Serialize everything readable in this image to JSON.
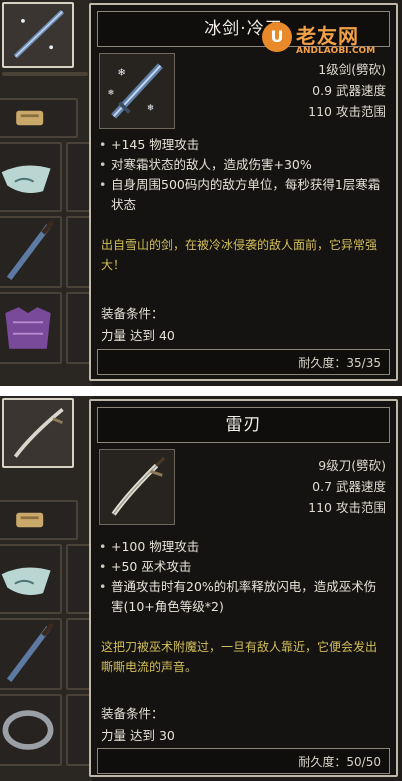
{
  "cards": [
    {
      "name": "冰剑·冷王",
      "stats": [
        "1级剑(劈砍)",
        "0.9 武器速度",
        "110 攻击范围"
      ],
      "affixes": [
        "+145 物理攻击",
        "对寒霜状态的敌人，造成伤害+30%",
        "自身周围500码内的敌方单位，每秒获得1层寒霜状态"
      ],
      "flavor": "出自雪山的剑，在被冷冰侵袭的敌人面前，它异常强大！",
      "requirement_heading": "装备条件：",
      "requirement_value": "力量 达到 40",
      "durability": "耐久度：35/35"
    },
    {
      "name": "雷刃",
      "stats": [
        "9级刀(劈砍)",
        "0.7 武器速度",
        "110 攻击范围"
      ],
      "affixes": [
        "+100 物理攻击",
        "+50 巫术攻击",
        "普通攻击时有20%的机率释放闪电，造成巫术伤害(10+角色等级*2)"
      ],
      "flavor": "这把刀被巫术附魔过，一旦有敌人靠近，它便会发出嘶嘶电流的声音。",
      "requirement_heading": "装备条件：",
      "requirement_value": "力量 达到 30",
      "durability": "耐久度：50/50"
    }
  ],
  "watermark": {
    "logo_glyph": "U",
    "site_name": "老友网",
    "site_domain": "ANDLAOBI.COM"
  },
  "colors": {
    "panel_bg": "#151311",
    "border": "#bfb8a8",
    "flavor_text": "#d2bf5a",
    "watermark": "#f3a047"
  }
}
